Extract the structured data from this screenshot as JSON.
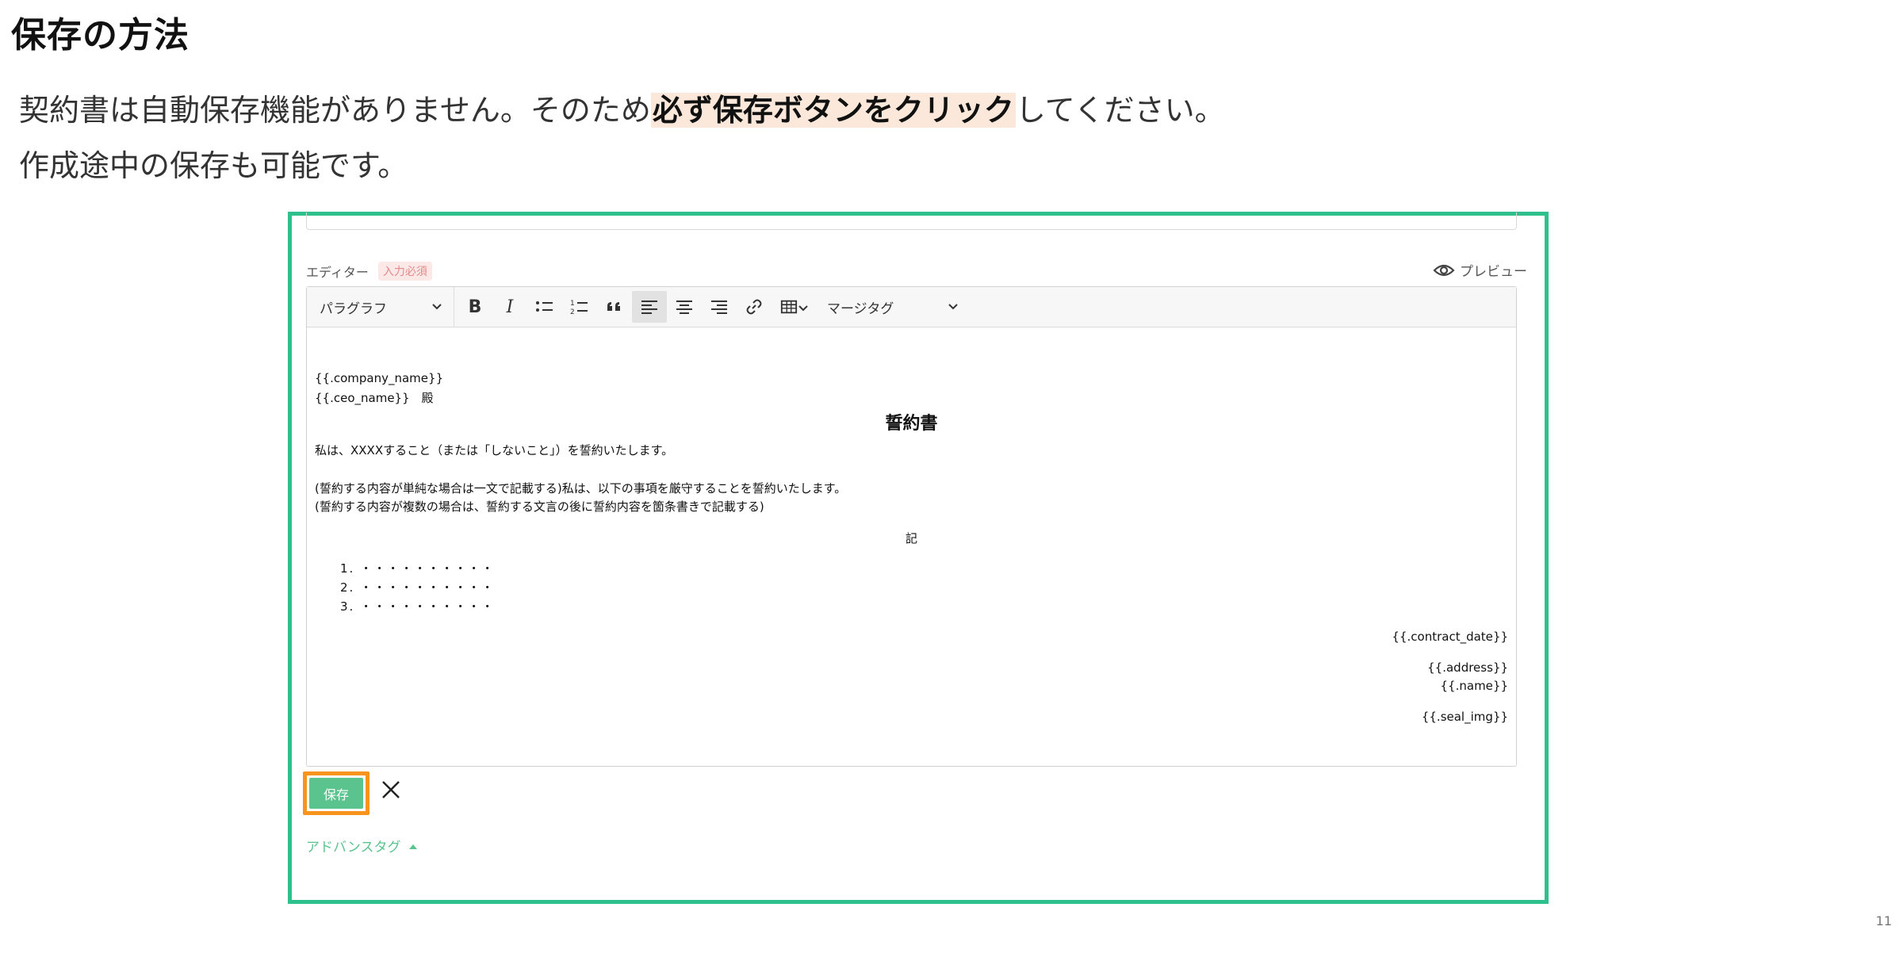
{
  "slide": {
    "heading": "保存の方法",
    "para1_before": "契約書は自動保存機能がありません。そのため",
    "para1_highlight": "必ず保存ボタンをクリック",
    "para1_after": "してください。",
    "para2": "作成途中の保存も可能です。",
    "page_number": "11"
  },
  "editor": {
    "label": "エディター",
    "required_badge": "入力必須",
    "preview_label": "プレビュー",
    "toolbar": {
      "paragraph_select": "パラグラフ",
      "tag_select": "マージタグ",
      "bold_icon": "B",
      "italic_icon": "I"
    },
    "content": {
      "company": "{{.company_name}}",
      "ceo": "{{.ceo_name}}　殿",
      "title": "誓約書",
      "pledge": "私は、XXXXすること（または「しないこと」）を誓約いたします。",
      "note1": "(誓約する内容が単純な場合は一文で記載する)私は、以下の事項を厳守することを誓約いたします。",
      "note2": "(誓約する内容が複数の場合は、誓約する文言の後に誓約内容を箇条書きで記載する)",
      "ki": "記",
      "list_items": [
        "1. ・・・・・・・・・・",
        "2. ・・・・・・・・・・",
        "3. ・・・・・・・・・・"
      ],
      "contract_date": "{{.contract_date}}",
      "address": "{{.address}}",
      "name": "{{.name}}",
      "seal": "{{.seal_img}}"
    },
    "save_button": "保存",
    "advanced_tags": "アドバンスタグ"
  },
  "colors": {
    "frame_border": "#2ec08d",
    "save_button": "#5bc48e",
    "save_highlight_border": "#f6941d",
    "text_highlight": "#fbe8da"
  }
}
